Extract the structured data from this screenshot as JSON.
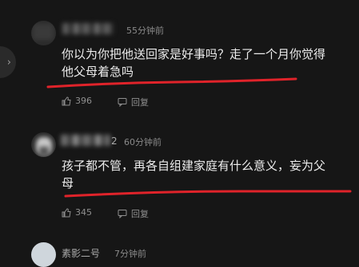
{
  "comments": [
    {
      "time": "55分钟前",
      "text_line1": "你以为你把他送回家是好事吗？走了一个月你觉得",
      "text_line2": "他父母着急吗",
      "likes": "396",
      "reply_label": "回复"
    },
    {
      "name_fragment": "2",
      "time": "60分钟前",
      "text_line1": "孩子都不管，再各自组建家庭有什么意义，妄为父",
      "text_line2": "母",
      "likes": "345",
      "reply_label": "回复"
    },
    {
      "name": "素影二号",
      "time": "7分钟前"
    }
  ],
  "colors": {
    "annotation": "#e0232a",
    "background": "#161616"
  },
  "icons": {
    "side_arrow": "chevron-right-icon",
    "like": "thumbs-up-icon",
    "reply": "reply-icon"
  }
}
